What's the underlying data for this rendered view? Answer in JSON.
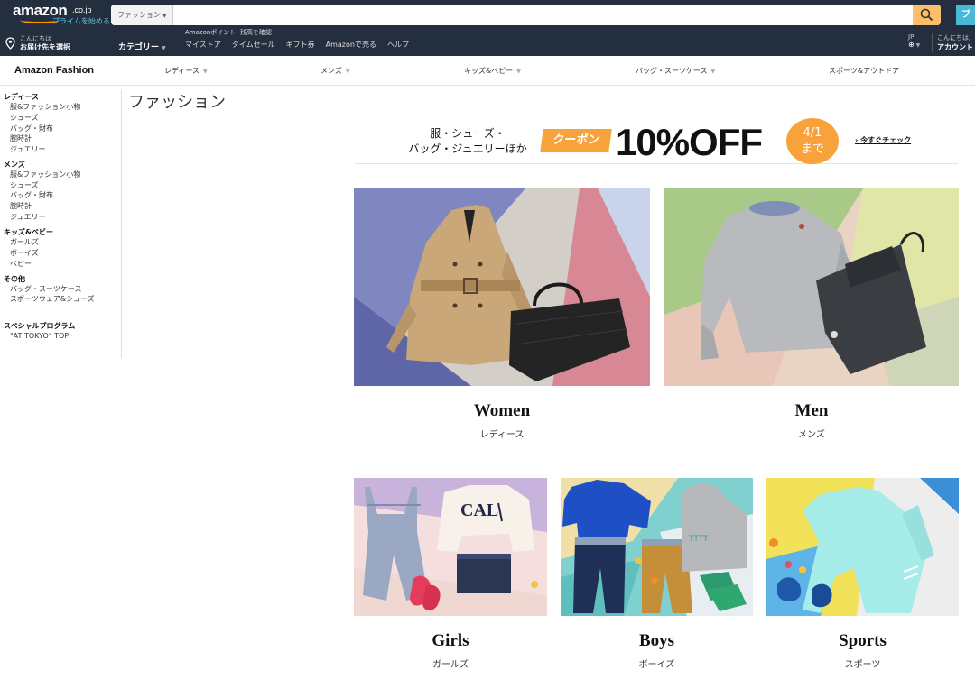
{
  "topbar": {
    "logo_text": "amazon",
    "logo_tld": ".co.jp",
    "prime_link": "プライムを始める",
    "search_dept": "ファッション",
    "search_placeholder": "",
    "right_edge_char": "プ"
  },
  "subbar": {
    "greeting": "こんにちは",
    "deliver_to": "お届け先を選択",
    "category": "カテゴリー",
    "points": "Amazonポイント: 残高を確認",
    "links": [
      "マイストア",
      "タイムセール",
      "ギフト券",
      "Amazonで売る",
      "ヘルプ"
    ],
    "lang": "JP",
    "account_greeting": "こんにちは,",
    "account": "アカウント"
  },
  "fashion_nav": {
    "brand": "Amazon Fashion",
    "items": [
      "レディース",
      "メンズ",
      "キッズ&ベビー",
      "バッグ・スーツケース",
      "スポーツ&アウトドア"
    ]
  },
  "sidebar": {
    "sections": [
      {
        "title": "レディース",
        "items": [
          "服&ファッション小物",
          "シューズ",
          "バッグ・財布",
          "腕時計",
          "ジュエリー"
        ]
      },
      {
        "title": "メンズ",
        "items": [
          "服&ファッション小物",
          "シューズ",
          "バッグ・財布",
          "腕時計",
          "ジュエリー"
        ]
      },
      {
        "title": "キッズ&ベビー",
        "items": [
          "ガールズ",
          "ボーイズ",
          "ベビー"
        ]
      },
      {
        "title": "その他",
        "items": [
          "バッグ・スーツケース",
          "スポーツウェア&シューズ"
        ]
      },
      {
        "title": "スペシャルプログラム",
        "items": [
          "\"AT TOKYO\" TOP"
        ]
      }
    ]
  },
  "page_title": "ファッション",
  "banner": {
    "line1": "服・シューズ・",
    "line2": "バッグ・ジュエリーほか",
    "coupon": "クーポン",
    "discount": "10%OFF",
    "date_line1": "4/1",
    "date_line2": "まで",
    "link": "今すぐチェック"
  },
  "tiles": [
    {
      "label": "Women",
      "sublabel": "レディース"
    },
    {
      "label": "Men",
      "sublabel": "メンズ"
    },
    {
      "label": "Girls",
      "sublabel": "ガールズ"
    },
    {
      "label": "Boys",
      "sublabel": "ボーイズ"
    },
    {
      "label": "Sports",
      "sublabel": "スポーツ"
    }
  ],
  "colors": {
    "nav_bg": "#232f3e",
    "search_button": "#febd69",
    "accent_orange": "#f7a23a",
    "prime_blue": "#5ac8e6"
  }
}
